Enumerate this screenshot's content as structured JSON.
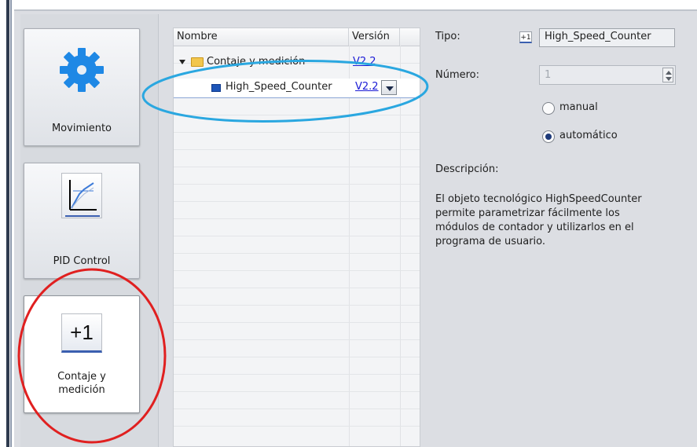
{
  "categories": [
    {
      "label": "Movimiento",
      "icon": "gear-icon"
    },
    {
      "label": "PID Control",
      "icon": "chart-icon"
    },
    {
      "label_line1": "Contaje y",
      "label_line2": "medición",
      "icon_text": "+1"
    }
  ],
  "tree": {
    "col_name": "Nombre",
    "col_version": "Versión",
    "rows": [
      {
        "name": "Contaje y medición",
        "version": "V2.2"
      },
      {
        "name": "High_Speed_Counter",
        "version": "V2.2"
      }
    ]
  },
  "detail": {
    "tipo_label": "Tipo:",
    "tipo_icon_text": "+1",
    "tipo_value": "High_Speed_Counter",
    "numero_label": "Número:",
    "numero_value": "1",
    "radio_manual": "manual",
    "radio_auto": "automático",
    "selected_mode": "automático",
    "desc_label": "Descripción:",
    "desc_text": "El objeto tecnológico HighSpeedCounter permite parametrizar fácilmente los módulos de contador y utilizarlos en el programa de usuario."
  },
  "colors": {
    "gear_blue": "#1e88e5",
    "annotation_blue": "#2aa7e0",
    "annotation_red": "#e02020",
    "folder_yellow": "#f2c64d"
  }
}
